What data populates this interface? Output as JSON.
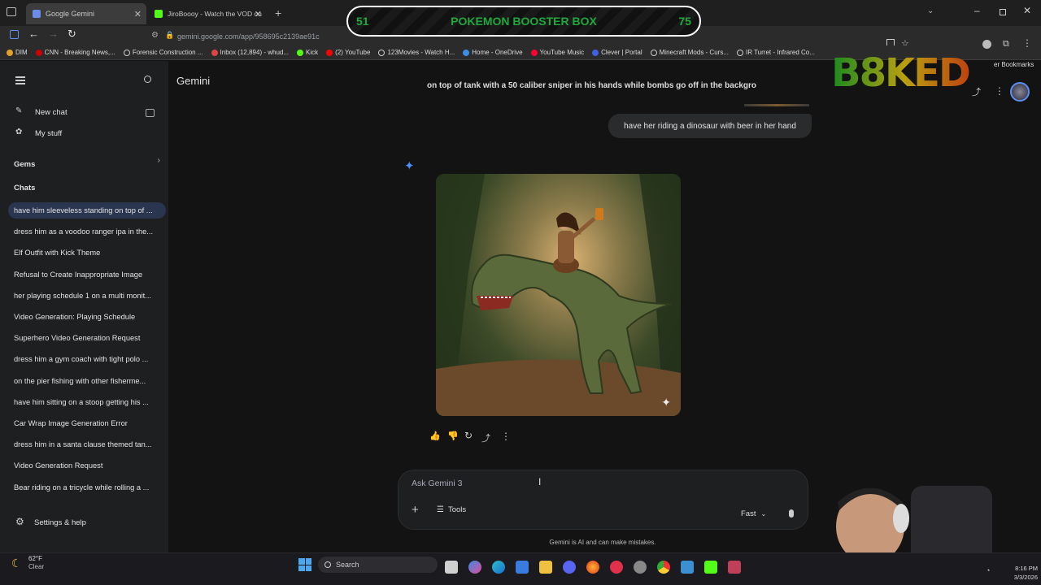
{
  "browser": {
    "tabs": [
      {
        "title": "Google Gemini",
        "active": true
      },
      {
        "title": "JiroBoooy - Watch the VOD on",
        "active": false
      }
    ],
    "url": "gemini.google.com/app/958695c2139ae91c",
    "bookmarks": [
      "DIM",
      "CNN - Breaking News,...",
      "Forensic Construction ...",
      "Inbox (12,894) - whud...",
      "Kick",
      "(2) YouTube",
      "123Movies - Watch H...",
      "Home - OneDrive",
      "YouTube Music",
      "Clever | Portal",
      "Minecraft Mods - Curs...",
      "IR Turret - Infrared Co..."
    ],
    "other_bookmarks": "er Bookmarks"
  },
  "overlay": {
    "left_num": "51",
    "title": "POKEMON BOOSTER BOX",
    "right_num": "75",
    "logo_text": "B8KED"
  },
  "sidebar": {
    "new_chat": "New chat",
    "my_stuff": "My stuff",
    "gems": "Gems",
    "chats_heading": "Chats",
    "chats": [
      "have him sleeveless standing on top of ...",
      "dress him as a voodoo ranger ipa in the...",
      "Elf Outfit with Kick Theme",
      "Refusal to Create Inappropriate Image",
      "her playing schedule 1 on a multi monit...",
      "Video Generation: Playing Schedule",
      "Superhero Video Generation Request",
      "dress him a gym coach with tight polo ...",
      "on the pier fishing with other fisherme...",
      "have him sitting on a stoop getting his ...",
      "Car Wrap Image Generation Error",
      "dress him in a santa clause themed tan...",
      "Video Generation Request",
      "Bear riding on a tricycle while rolling a ..."
    ],
    "settings": "Settings & help"
  },
  "main": {
    "app_title": "Gemini",
    "prev_message": "on top of tank with a 50 caliber sniper in his hands while bombs go off in the backgro",
    "user_message": "have her riding a dinosaur with beer in her hand",
    "composer_placeholder": "Ask Gemini 3",
    "tools_label": "Tools",
    "mode_label": "Fast",
    "disclaimer": "Gemini is AI and can make mistakes."
  },
  "taskbar": {
    "weather_temp": "62°F",
    "weather_desc": "Clear",
    "search_label": "Search",
    "time": "8:16 PM",
    "date": "3/3/2026"
  },
  "colors": {
    "accent": "#4c8df6",
    "banner_green": "#1fa83c",
    "active_chat": "#2a3550"
  }
}
